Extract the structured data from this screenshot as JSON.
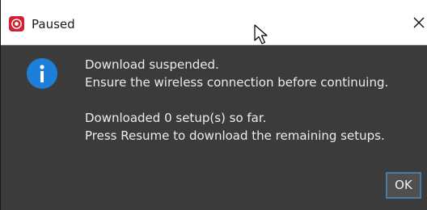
{
  "window": {
    "title": "Paused",
    "app_icon": "app-logo-icon",
    "close_icon": "close-icon"
  },
  "message": {
    "icon": "info-icon",
    "line1": "Download suspended.",
    "line2": "Ensure the wireless connection before continuing.",
    "line3": "Downloaded 0 setup(s) so far.",
    "line4": "Press Resume to download the remaining setups."
  },
  "buttons": {
    "ok_label": "OK"
  },
  "colors": {
    "dialog_background": "#3b3b3b",
    "titlebar_background": "#ffffff",
    "info_icon": "#1e7fd8",
    "app_icon": "#d32030",
    "button_focus_border": "#2a87d6"
  }
}
